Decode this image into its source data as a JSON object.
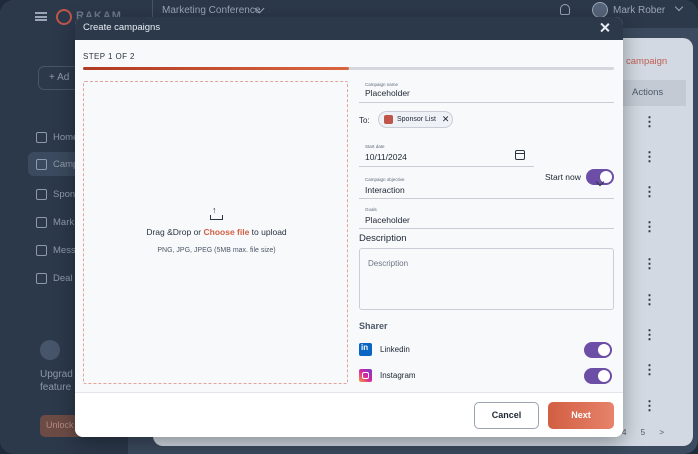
{
  "background": {
    "brand_name": "RAKAM",
    "event_selector": "Marketing Conference",
    "user_name": "Mark Rober",
    "add_button_label": "+ Ad",
    "nav_items": [
      "Home",
      "Camp",
      "Spon",
      "Mark",
      "Mess",
      "Deal"
    ],
    "upgrade_text": "Upgrad unlock l feature",
    "unlock_button_label": "Unlock",
    "new_campaign_link": "campaign",
    "actions_header": "Actions",
    "pagination": "4  5  >"
  },
  "modal": {
    "title": "Create campaigns",
    "step_label": "STEP 1 OF 2",
    "progress": 0.5,
    "dropzone": {
      "text_before": "Drag &Drop or ",
      "link": "Choose file",
      "text_after": " to upload",
      "hint": "PNG, JPG, JPEG (5MB max. file size)"
    },
    "campaign_name": {
      "label": "Campaign name",
      "value": "Placeholder"
    },
    "to": {
      "label": "To:",
      "chip": "Sponsor List"
    },
    "start_date": {
      "label": "Start date",
      "value": "10/11/2024"
    },
    "start_now": {
      "label": "Start now",
      "enabled": true
    },
    "objective": {
      "label": "Campaign objective",
      "value": "Interaction"
    },
    "goals": {
      "label": "Goals",
      "value": "Placeholder"
    },
    "description": {
      "title": "Description",
      "placeholder": "Description"
    },
    "sharer": {
      "title": "Sharer",
      "items": [
        {
          "label": "Linkedin",
          "enabled": true
        },
        {
          "label": "Instagram",
          "enabled": true
        }
      ]
    },
    "buttons": {
      "cancel": "Cancel",
      "next": "Next"
    }
  },
  "colors": {
    "accent": "#d25e43",
    "toggle_on": "#6d4ea6",
    "header": "#2c394b"
  }
}
